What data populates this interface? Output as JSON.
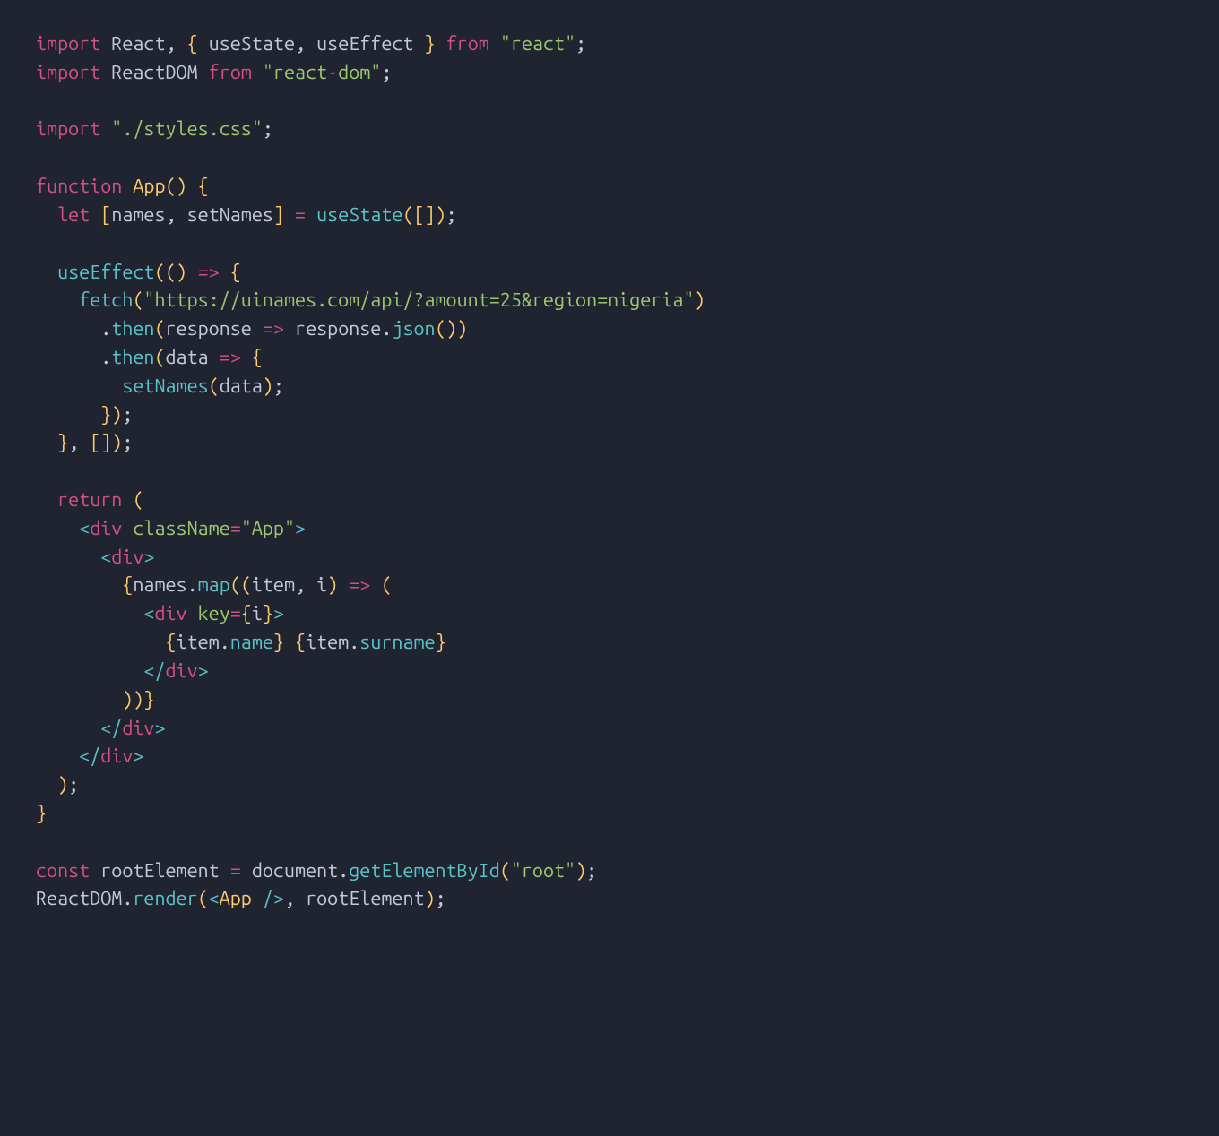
{
  "code": {
    "lines": [
      [
        {
          "c": "kw",
          "t": "import"
        },
        {
          "c": "def",
          "t": " "
        },
        {
          "c": "var",
          "t": "React"
        },
        {
          "c": "punc",
          "t": ", "
        },
        {
          "c": "paren",
          "t": "{"
        },
        {
          "c": "def",
          "t": " "
        },
        {
          "c": "var",
          "t": "useState"
        },
        {
          "c": "punc",
          "t": ", "
        },
        {
          "c": "var",
          "t": "useEffect"
        },
        {
          "c": "def",
          "t": " "
        },
        {
          "c": "paren",
          "t": "}"
        },
        {
          "c": "def",
          "t": " "
        },
        {
          "c": "kw",
          "t": "from"
        },
        {
          "c": "def",
          "t": " "
        },
        {
          "c": "str",
          "t": "\"react\""
        },
        {
          "c": "punc",
          "t": ";"
        }
      ],
      [
        {
          "c": "kw",
          "t": "import"
        },
        {
          "c": "def",
          "t": " "
        },
        {
          "c": "var",
          "t": "ReactDOM"
        },
        {
          "c": "def",
          "t": " "
        },
        {
          "c": "kw",
          "t": "from"
        },
        {
          "c": "def",
          "t": " "
        },
        {
          "c": "str",
          "t": "\"react-dom\""
        },
        {
          "c": "punc",
          "t": ";"
        }
      ],
      [],
      [
        {
          "c": "kw",
          "t": "import"
        },
        {
          "c": "def",
          "t": " "
        },
        {
          "c": "str",
          "t": "\"./styles.css\""
        },
        {
          "c": "punc",
          "t": ";"
        }
      ],
      [],
      [
        {
          "c": "kw",
          "t": "function"
        },
        {
          "c": "def",
          "t": " "
        },
        {
          "c": "app",
          "t": "App"
        },
        {
          "c": "paren",
          "t": "()"
        },
        {
          "c": "def",
          "t": " "
        },
        {
          "c": "paren",
          "t": "{"
        }
      ],
      [
        {
          "c": "def",
          "t": "  "
        },
        {
          "c": "kw",
          "t": "let"
        },
        {
          "c": "def",
          "t": " "
        },
        {
          "c": "paren",
          "t": "["
        },
        {
          "c": "var",
          "t": "names"
        },
        {
          "c": "punc",
          "t": ", "
        },
        {
          "c": "var",
          "t": "setNames"
        },
        {
          "c": "paren",
          "t": "]"
        },
        {
          "c": "def",
          "t": " "
        },
        {
          "c": "op",
          "t": "="
        },
        {
          "c": "def",
          "t": " "
        },
        {
          "c": "fn",
          "t": "useState"
        },
        {
          "c": "paren",
          "t": "([])"
        },
        {
          "c": "punc",
          "t": ";"
        }
      ],
      [],
      [
        {
          "c": "def",
          "t": "  "
        },
        {
          "c": "fn",
          "t": "useEffect"
        },
        {
          "c": "paren",
          "t": "(()"
        },
        {
          "c": "def",
          "t": " "
        },
        {
          "c": "op",
          "t": "=>"
        },
        {
          "c": "def",
          "t": " "
        },
        {
          "c": "paren",
          "t": "{"
        }
      ],
      [
        {
          "c": "def",
          "t": "    "
        },
        {
          "c": "fn",
          "t": "fetch"
        },
        {
          "c": "paren",
          "t": "("
        },
        {
          "c": "str",
          "t": "\"https://uinames.com/api/?amount=25&region=nigeria\""
        },
        {
          "c": "paren",
          "t": ")"
        }
      ],
      [
        {
          "c": "def",
          "t": "      "
        },
        {
          "c": "punc",
          "t": "."
        },
        {
          "c": "fn",
          "t": "then"
        },
        {
          "c": "paren",
          "t": "("
        },
        {
          "c": "var",
          "t": "response"
        },
        {
          "c": "def",
          "t": " "
        },
        {
          "c": "op",
          "t": "=>"
        },
        {
          "c": "def",
          "t": " "
        },
        {
          "c": "var",
          "t": "response"
        },
        {
          "c": "punc",
          "t": "."
        },
        {
          "c": "fn",
          "t": "json"
        },
        {
          "c": "paren",
          "t": "())"
        }
      ],
      [
        {
          "c": "def",
          "t": "      "
        },
        {
          "c": "punc",
          "t": "."
        },
        {
          "c": "fn",
          "t": "then"
        },
        {
          "c": "paren",
          "t": "("
        },
        {
          "c": "var",
          "t": "data"
        },
        {
          "c": "def",
          "t": " "
        },
        {
          "c": "op",
          "t": "=>"
        },
        {
          "c": "def",
          "t": " "
        },
        {
          "c": "paren",
          "t": "{"
        }
      ],
      [
        {
          "c": "def",
          "t": "        "
        },
        {
          "c": "fn",
          "t": "setNames"
        },
        {
          "c": "paren",
          "t": "("
        },
        {
          "c": "var",
          "t": "data"
        },
        {
          "c": "paren",
          "t": ")"
        },
        {
          "c": "punc",
          "t": ";"
        }
      ],
      [
        {
          "c": "def",
          "t": "      "
        },
        {
          "c": "paren",
          "t": "})"
        },
        {
          "c": "punc",
          "t": ";"
        }
      ],
      [
        {
          "c": "def",
          "t": "  "
        },
        {
          "c": "paren",
          "t": "}"
        },
        {
          "c": "punc",
          "t": ", "
        },
        {
          "c": "paren",
          "t": "[])"
        },
        {
          "c": "punc",
          "t": ";"
        }
      ],
      [],
      [
        {
          "c": "def",
          "t": "  "
        },
        {
          "c": "kw",
          "t": "return"
        },
        {
          "c": "def",
          "t": " "
        },
        {
          "c": "paren",
          "t": "("
        }
      ],
      [
        {
          "c": "def",
          "t": "    "
        },
        {
          "c": "tagbr",
          "t": "<"
        },
        {
          "c": "tag",
          "t": "div"
        },
        {
          "c": "def",
          "t": " "
        },
        {
          "c": "attr",
          "t": "className"
        },
        {
          "c": "op",
          "t": "="
        },
        {
          "c": "str",
          "t": "\"App\""
        },
        {
          "c": "tagbr",
          "t": ">"
        }
      ],
      [
        {
          "c": "def",
          "t": "      "
        },
        {
          "c": "tagbr",
          "t": "<"
        },
        {
          "c": "tag",
          "t": "div"
        },
        {
          "c": "tagbr",
          "t": ">"
        }
      ],
      [
        {
          "c": "def",
          "t": "        "
        },
        {
          "c": "paren",
          "t": "{"
        },
        {
          "c": "var",
          "t": "names"
        },
        {
          "c": "punc",
          "t": "."
        },
        {
          "c": "fn",
          "t": "map"
        },
        {
          "c": "paren",
          "t": "(("
        },
        {
          "c": "var",
          "t": "item"
        },
        {
          "c": "punc",
          "t": ", "
        },
        {
          "c": "var",
          "t": "i"
        },
        {
          "c": "paren",
          "t": ")"
        },
        {
          "c": "def",
          "t": " "
        },
        {
          "c": "op",
          "t": "=>"
        },
        {
          "c": "def",
          "t": " "
        },
        {
          "c": "paren",
          "t": "("
        }
      ],
      [
        {
          "c": "def",
          "t": "          "
        },
        {
          "c": "tagbr",
          "t": "<"
        },
        {
          "c": "tag",
          "t": "div"
        },
        {
          "c": "def",
          "t": " "
        },
        {
          "c": "attr",
          "t": "key"
        },
        {
          "c": "op",
          "t": "="
        },
        {
          "c": "paren",
          "t": "{"
        },
        {
          "c": "var",
          "t": "i"
        },
        {
          "c": "paren",
          "t": "}"
        },
        {
          "c": "tagbr",
          "t": ">"
        }
      ],
      [
        {
          "c": "def",
          "t": "            "
        },
        {
          "c": "paren",
          "t": "{"
        },
        {
          "c": "var",
          "t": "item"
        },
        {
          "c": "punc",
          "t": "."
        },
        {
          "c": "fn",
          "t": "name"
        },
        {
          "c": "paren",
          "t": "}"
        },
        {
          "c": "def",
          "t": " "
        },
        {
          "c": "paren",
          "t": "{"
        },
        {
          "c": "var",
          "t": "item"
        },
        {
          "c": "punc",
          "t": "."
        },
        {
          "c": "fn",
          "t": "surname"
        },
        {
          "c": "paren",
          "t": "}"
        }
      ],
      [
        {
          "c": "def",
          "t": "          "
        },
        {
          "c": "tagbr",
          "t": "</"
        },
        {
          "c": "tag",
          "t": "div"
        },
        {
          "c": "tagbr",
          "t": ">"
        }
      ],
      [
        {
          "c": "def",
          "t": "        "
        },
        {
          "c": "paren",
          "t": "))}"
        }
      ],
      [
        {
          "c": "def",
          "t": "      "
        },
        {
          "c": "tagbr",
          "t": "</"
        },
        {
          "c": "tag",
          "t": "div"
        },
        {
          "c": "tagbr",
          "t": ">"
        }
      ],
      [
        {
          "c": "def",
          "t": "    "
        },
        {
          "c": "tagbr",
          "t": "</"
        },
        {
          "c": "tag",
          "t": "div"
        },
        {
          "c": "tagbr",
          "t": ">"
        }
      ],
      [
        {
          "c": "def",
          "t": "  "
        },
        {
          "c": "paren",
          "t": ")"
        },
        {
          "c": "punc",
          "t": ";"
        }
      ],
      [
        {
          "c": "paren",
          "t": "}"
        }
      ],
      [],
      [
        {
          "c": "kw",
          "t": "const"
        },
        {
          "c": "def",
          "t": " "
        },
        {
          "c": "var",
          "t": "rootElement"
        },
        {
          "c": "def",
          "t": " "
        },
        {
          "c": "op",
          "t": "="
        },
        {
          "c": "def",
          "t": " "
        },
        {
          "c": "var",
          "t": "document"
        },
        {
          "c": "punc",
          "t": "."
        },
        {
          "c": "fn",
          "t": "getElementById"
        },
        {
          "c": "paren",
          "t": "("
        },
        {
          "c": "str",
          "t": "\"root\""
        },
        {
          "c": "paren",
          "t": ")"
        },
        {
          "c": "punc",
          "t": ";"
        }
      ],
      [
        {
          "c": "var",
          "t": "ReactDOM"
        },
        {
          "c": "punc",
          "t": "."
        },
        {
          "c": "fn",
          "t": "render"
        },
        {
          "c": "paren",
          "t": "("
        },
        {
          "c": "tagbr",
          "t": "<"
        },
        {
          "c": "app",
          "t": "App"
        },
        {
          "c": "def",
          "t": " "
        },
        {
          "c": "tagbr",
          "t": "/>"
        },
        {
          "c": "punc",
          "t": ", "
        },
        {
          "c": "var",
          "t": "rootElement"
        },
        {
          "c": "paren",
          "t": ")"
        },
        {
          "c": "punc",
          "t": ";"
        }
      ]
    ]
  }
}
